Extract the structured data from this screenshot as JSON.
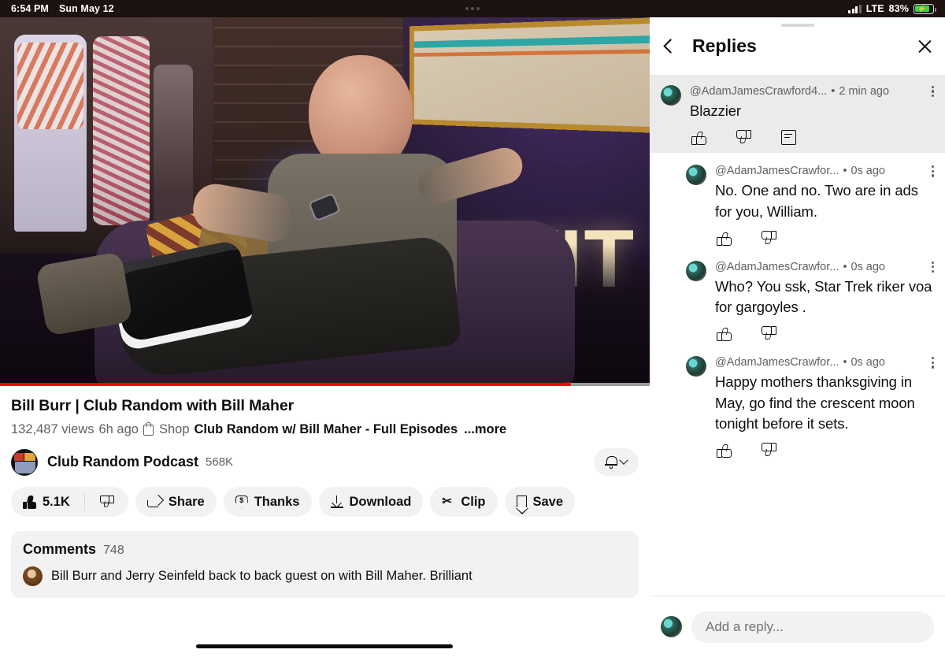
{
  "status_bar": {
    "time": "6:54 PM",
    "date": "Sun May 12",
    "network": "LTE",
    "battery": "83%",
    "battery_charging_icon": "lightning-bolt-icon"
  },
  "video": {
    "title": "Bill Burr | Club Random with Bill Maher",
    "views": "132,487 views",
    "age": "6h ago",
    "shop_label": "Shop",
    "playlist": "Club Random w/ Bill Maher - Full Episodes",
    "more_label": "...more",
    "on_screen_text": "WIT",
    "progress_percent": 87
  },
  "channel": {
    "name": "Club Random Podcast",
    "subscribers": "568K",
    "bell_icon": "notification-bell-icon"
  },
  "actions": [
    {
      "name": "like",
      "label": "5.1K",
      "icon": "thumbs-up-icon"
    },
    {
      "name": "dislike",
      "label": "",
      "icon": "thumbs-down-icon"
    },
    {
      "name": "share",
      "label": "Share",
      "icon": "share-arrow-icon"
    },
    {
      "name": "thanks",
      "label": "Thanks",
      "icon": "thanks-heart-dollar-icon"
    },
    {
      "name": "download",
      "label": "Download",
      "icon": "download-icon"
    },
    {
      "name": "clip",
      "label": "Clip",
      "icon": "scissors-icon"
    },
    {
      "name": "save",
      "label": "Save",
      "icon": "bookmark-icon"
    }
  ],
  "comments_section": {
    "title": "Comments",
    "count": "748",
    "top_comment": "Bill Burr and Jerry Seinfeld back to back guest on with Bill Maher. Brilliant"
  },
  "replies_panel": {
    "title": "Replies",
    "back_icon": "chevron-left-icon",
    "close_icon": "close-x-icon",
    "replies": [
      {
        "handle": "@AdamJamesCrawford4...",
        "separator": "•",
        "time": "2 min ago",
        "text": "Blazzier",
        "highlighted": true,
        "has_reply_button": true
      },
      {
        "handle": "@AdamJamesCrawfor...",
        "separator": "•",
        "time": "0s ago",
        "text": "No. One and no. Two are in ads for you, William.",
        "highlighted": false,
        "has_reply_button": false
      },
      {
        "handle": "@AdamJamesCrawfor...",
        "separator": "•",
        "time": "0s ago",
        "text": "Who? You ssk, Star Trek riker voa for gargoyles .",
        "highlighted": false,
        "has_reply_button": false
      },
      {
        "handle": "@AdamJamesCrawfor...",
        "separator": "•",
        "time": "0s ago",
        "text": "Happy mothers thanksgiving in May, go find the crescent moon tonight before it sets.",
        "highlighted": false,
        "has_reply_button": false
      }
    ],
    "composer_placeholder": "Add a reply..."
  },
  "colors": {
    "accent_red": "#ff0000",
    "chip_bg": "#f2f2f2",
    "text_primary": "#0f0f0f",
    "text_secondary": "#606060",
    "battery_green": "#32d74b"
  }
}
